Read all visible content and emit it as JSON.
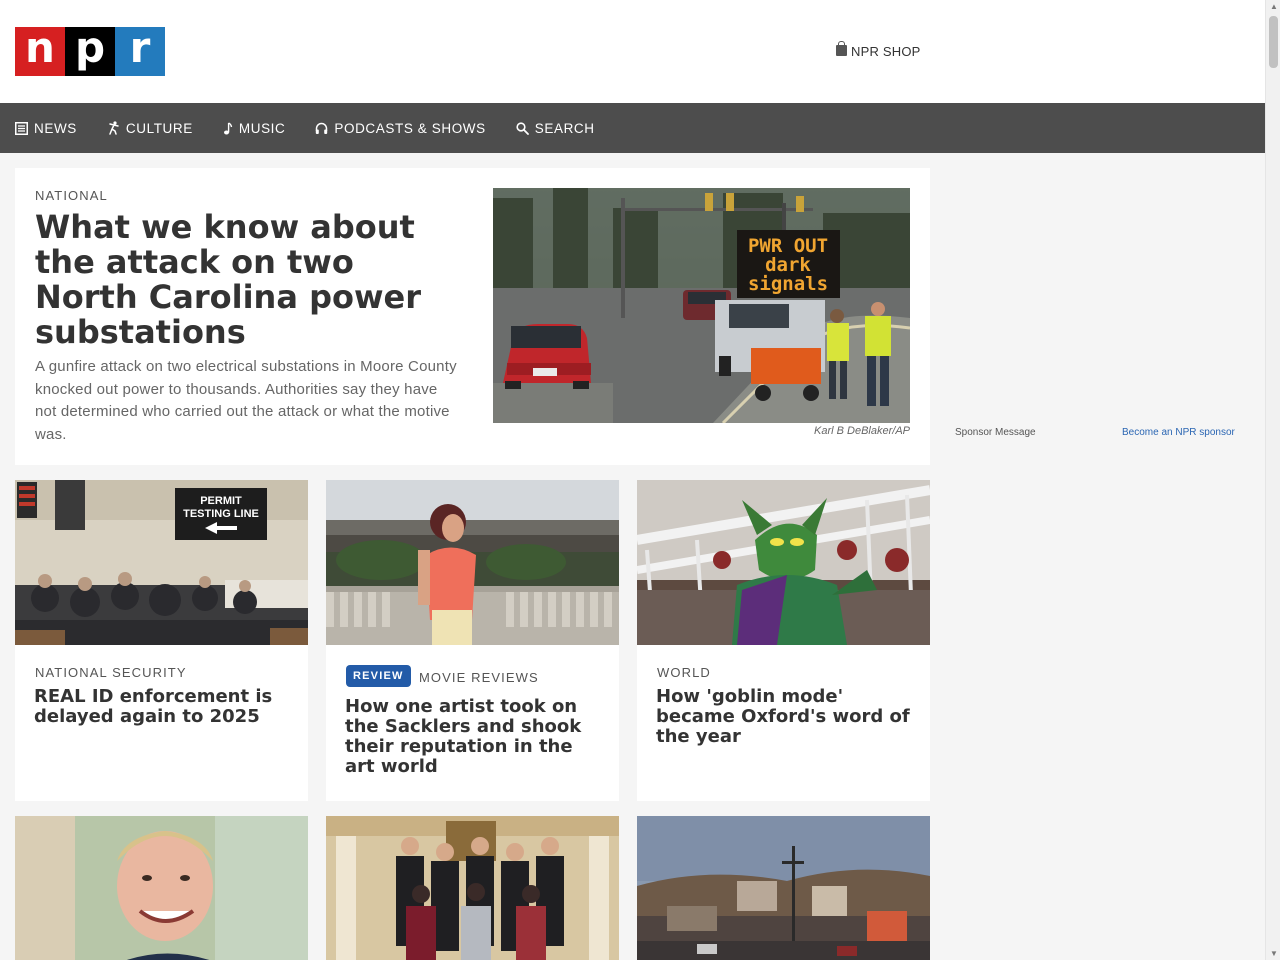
{
  "header": {
    "logo": {
      "n": "n",
      "p": "p",
      "r": "r"
    },
    "shop_label": "NPR SHOP"
  },
  "nav": [
    {
      "label": "NEWS",
      "icon": "newspaper-icon"
    },
    {
      "label": "CULTURE",
      "icon": "dancer-icon"
    },
    {
      "label": "MUSIC",
      "icon": "music-note-icon"
    },
    {
      "label": "PODCASTS & SHOWS",
      "icon": "headphones-icon"
    },
    {
      "label": "SEARCH",
      "icon": "search-icon"
    }
  ],
  "featured": {
    "slug": "NATIONAL",
    "headline": "What we know about the attack on two North Carolina power substations",
    "teaser": "A gunfire attack on two electrical substations in Moore County knocked out power to thousands. Authorities say they have not determined who carried out the attack or what the motive was.",
    "sign_line1": "PWR OUT",
    "sign_line2": "dark",
    "sign_line3": "signals",
    "credit": "Karl B DeBlaker/AP"
  },
  "stories": [
    {
      "slug": "NATIONAL SECURITY",
      "headline": "REAL ID enforcement is delayed again to 2025",
      "sign_line1": "PERMIT",
      "sign_line2": "TESTING LINE"
    },
    {
      "badge": "REVIEW",
      "slug": "MOVIE REVIEWS",
      "headline": "How one artist took on the Sacklers and shook their reputation in the art world"
    },
    {
      "slug": "WORLD",
      "headline": "How 'goblin mode' became Oxford's word of the year"
    }
  ],
  "sidebar": {
    "sponsor_label": "Sponsor Message",
    "become_link": "Become an NPR sponsor"
  },
  "colors": {
    "logo_red": "#d62021",
    "logo_black": "#000000",
    "logo_blue": "#237bbd",
    "nav_bg": "#4d4d4d",
    "badge_blue": "#235ba8"
  }
}
